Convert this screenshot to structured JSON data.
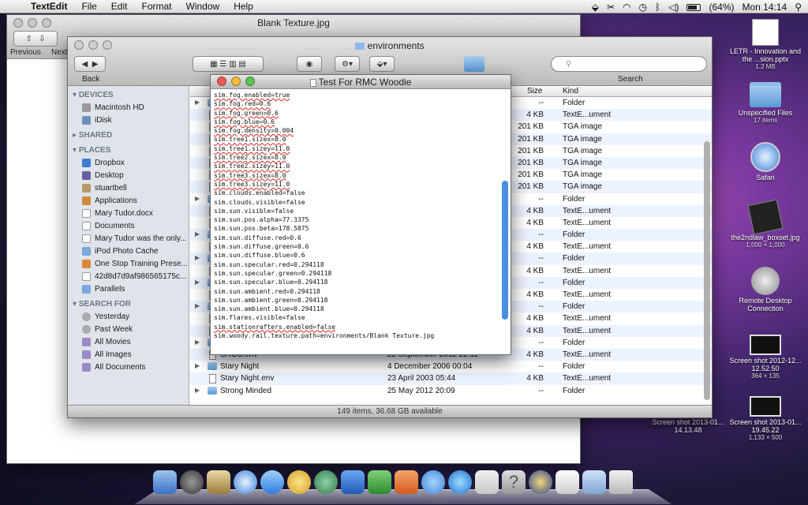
{
  "menubar": {
    "app": "TextEdit",
    "menus": [
      "File",
      "Edit",
      "Format",
      "Window",
      "Help"
    ],
    "battery": "(64%)",
    "clock": "Mon 14:14"
  },
  "desktop": {
    "icons": [
      {
        "name": "LETR - Innovation and the ...sion.pptx",
        "sub": "1.2 MB"
      },
      {
        "name": "Unspecified Files",
        "sub": "17 items"
      },
      {
        "name": "Safari",
        "sub": ""
      },
      {
        "name": "the2ndlaw_boxset.jpg",
        "sub": "1,000 × 1,000"
      },
      {
        "name": "Remote Desktop Connection",
        "sub": ""
      },
      {
        "name": "Screen shot 2012-12... 12.52.50",
        "sub": "364 × 135"
      },
      {
        "name": "Screen shot 2013-01... 14.13.48",
        "sub": ""
      },
      {
        "name": "Screen shot 2013-01... 19.45.22",
        "sub": "1,133 × 500"
      }
    ]
  },
  "textedit_back": {
    "title": "Blank Texture.jpg",
    "previous": "Previous",
    "next": "Next"
  },
  "finder": {
    "title": "environments",
    "back_label": "Back",
    "search_label": "Search",
    "columns": {
      "size": "Size",
      "kind": "Kind"
    },
    "sidebar": {
      "devices_head": "DEVICES",
      "devices": [
        "Macintosh HD",
        "iDisk"
      ],
      "shared_head": "SHARED",
      "places_head": "PLACES",
      "places": [
        "Dropbox",
        "Desktop",
        "stuartbell",
        "Applications",
        "Mary Tudor.docx",
        "Documents",
        "Mary Tudor was the only...",
        "iPod Photo Cache",
        "One Stop Training Prese...",
        "42d8d7d9af986565175c...",
        "Parallels"
      ],
      "search_head": "SEARCH FOR",
      "search": [
        "Yesterday",
        "Past Week",
        "All Movies",
        "All Images",
        "All Documents"
      ]
    },
    "rows": [
      {
        "name": "",
        "date": "",
        "size": "--",
        "kind": "Folder",
        "folder": true
      },
      {
        "name": "",
        "date": "",
        "size": "4 KB",
        "kind": "TextE...ument",
        "folder": false
      },
      {
        "name": "",
        "date": "",
        "size": "201 KB",
        "kind": "TGA image",
        "folder": false
      },
      {
        "name": "",
        "date": "",
        "size": "201 KB",
        "kind": "TGA image",
        "folder": false
      },
      {
        "name": "",
        "date": "",
        "size": "201 KB",
        "kind": "TGA image",
        "folder": false
      },
      {
        "name": "",
        "date": "",
        "size": "201 KB",
        "kind": "TGA image",
        "folder": false
      },
      {
        "name": "",
        "date": "",
        "size": "201 KB",
        "kind": "TGA image",
        "folder": false
      },
      {
        "name": "",
        "date": "",
        "size": "201 KB",
        "kind": "TGA image",
        "folder": false
      },
      {
        "name": "",
        "date": "",
        "size": "--",
        "kind": "Folder",
        "folder": true
      },
      {
        "name": "",
        "date": "",
        "size": "4 KB",
        "kind": "TextE...ument",
        "folder": false
      },
      {
        "name": "",
        "date": "",
        "size": "4 KB",
        "kind": "TextE...ument",
        "folder": false
      },
      {
        "name": "",
        "date": "",
        "size": "--",
        "kind": "Folder",
        "folder": true
      },
      {
        "name": "",
        "date": "",
        "size": "4 KB",
        "kind": "TextE...ument",
        "folder": false
      },
      {
        "name": "",
        "date": "",
        "size": "--",
        "kind": "Folder",
        "folder": true
      },
      {
        "name": "",
        "date": "",
        "size": "4 KB",
        "kind": "TextE...ument",
        "folder": false
      },
      {
        "name": "",
        "date": "",
        "size": "--",
        "kind": "Folder",
        "folder": true
      },
      {
        "name": "",
        "date": "",
        "size": "4 KB",
        "kind": "TextE...ument",
        "folder": false
      },
      {
        "name": "",
        "date": "",
        "size": "--",
        "kind": "Folder",
        "folder": true
      },
      {
        "name": "",
        "date": "",
        "size": "4 KB",
        "kind": "TextE...ument",
        "folder": false
      },
      {
        "name": "",
        "date": "",
        "size": "4 KB",
        "kind": "TextE...ument",
        "folder": false
      },
      {
        "name": "",
        "date": "",
        "size": "--",
        "kind": "Folder",
        "folder": true
      },
      {
        "name": "SROS.env",
        "date": "22 September 2012 22:11",
        "size": "4 KB",
        "kind": "TextE...ument",
        "folder": false
      },
      {
        "name": "Stary Night",
        "date": "4 December 2006 00:04",
        "size": "--",
        "kind": "Folder",
        "folder": true
      },
      {
        "name": "Stary Night.env",
        "date": "23 April 2003 05:44",
        "size": "4 KB",
        "kind": "TextE...ument",
        "folder": false
      },
      {
        "name": "Strong Minded",
        "date": "25 May 2012 20:09",
        "size": "--",
        "kind": "Folder",
        "folder": true
      }
    ],
    "status": "149 items, 36.68 GB available"
  },
  "editor": {
    "title": "Test For RMC Woodie",
    "lines": [
      "sim.fog.enabled=true",
      "sim.fog.red=0.6",
      "sim.fog.green=0.6",
      "sim.fog.blue=0.6",
      "sim.fog.density=0.004",
      "sim.tree1.sizex=8.0",
      "sim.tree1.sizey=11.0",
      "sim.tree2.sizex=8.0",
      "sim.tree2.sizey=11.0",
      "sim.tree3.sizex=8.0",
      "sim.tree3.sizey=11.0",
      "sim.clouds.enabled=false",
      "sim.clouds.visible=false",
      "sim.sun.visible=false",
      "sim.sun.pos.alpha=77.3375",
      "sim.sun.pos.beta=178.5875",
      "sim.sun.diffuse.red=0.6",
      "sim.sun.diffuse.green=0.6",
      "sim.sun.diffuse.blue=0.6",
      "sim.sun.specular.red=0.294118",
      "sim.sun.specular.green=0.294118",
      "sim.sun.specular.blue=0.294118",
      "sim.sun.ambient.red=0.294118",
      "sim.sun.ambient.green=0.294118",
      "sim.sun.ambient.blue=0.294118",
      "sim.flares.visible=false",
      "sim.stationrafters.enabled=false",
      "sim.woody.rail.texture.path=environments/Blank Texture.jpg"
    ]
  },
  "colors": {
    "close": "#ee5b55",
    "minimize": "#f4bc3d",
    "zoom": "#5fc452",
    "selection": "#3875d7"
  }
}
